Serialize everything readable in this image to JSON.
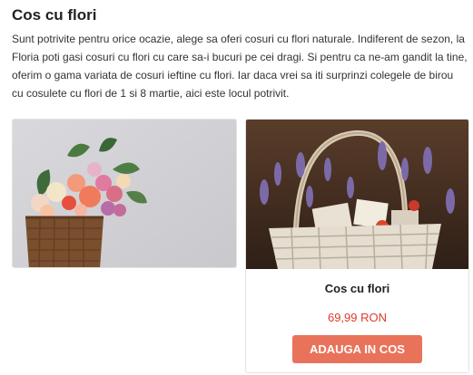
{
  "section": {
    "title": "Cos cu flori",
    "description": "Sunt potrivite pentru orice ocazie, alege sa oferi cosuri cu flori naturale. Indiferent de sezon, la Floria poti gasi cosuri cu flori cu care sa-i bucuri pe cei dragi. Si pentru ca ne-am gandit la tine, oferim o gama variata de cosuri ieftine cu flori. Iar daca vrei sa iti surprinzi colegele de birou cu cosulete cu flori de 1 si 8 martie, aici este locul potrivit."
  },
  "cards": [
    {
      "image": "basket-of-mixed-flowers-photo"
    },
    {
      "image": "wicker-basket-with-lavender-photo",
      "name": "Cos cu flori",
      "price": "69,99 RON",
      "button_label": "ADAUGA IN COS"
    }
  ],
  "colors": {
    "price": "#e03a2b",
    "button": "#e8735a"
  }
}
